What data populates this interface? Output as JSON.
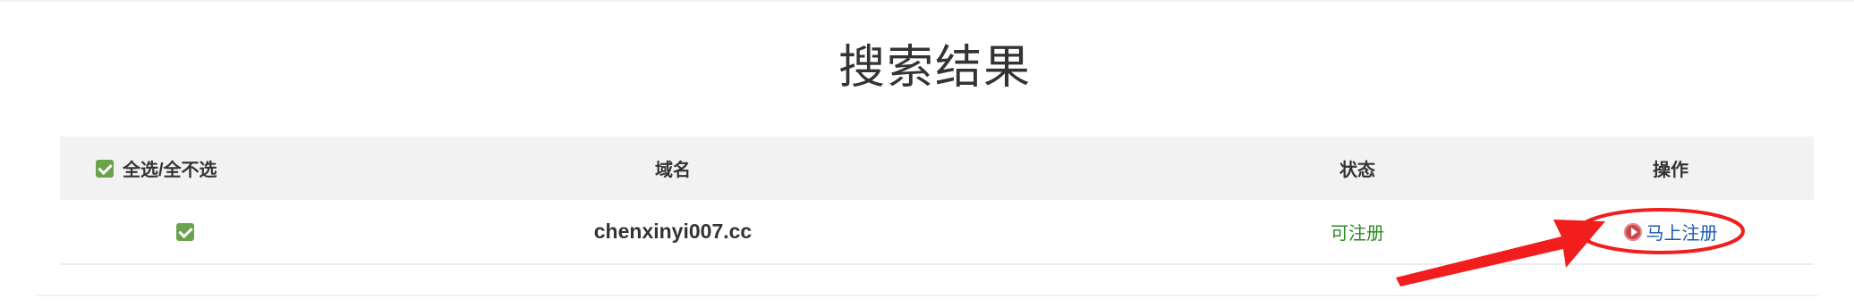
{
  "title": "搜索结果",
  "table": {
    "headers": {
      "select_all": "全选/全不选",
      "domain": "域名",
      "status": "状态",
      "action": "操作"
    },
    "rows": [
      {
        "checked": true,
        "domain": "chenxinyi007.cc",
        "status": "可注册",
        "action": "马上注册"
      }
    ]
  },
  "colors": {
    "status_available": "#2d8a24",
    "action_link": "#1a57b8",
    "checkbox": "#6aa34b",
    "annotation": "#f21d1d"
  },
  "icons": {
    "checkbox": "checkbox-checked-icon",
    "action": "play-circle-icon",
    "annotation": "arrow-annotation"
  }
}
